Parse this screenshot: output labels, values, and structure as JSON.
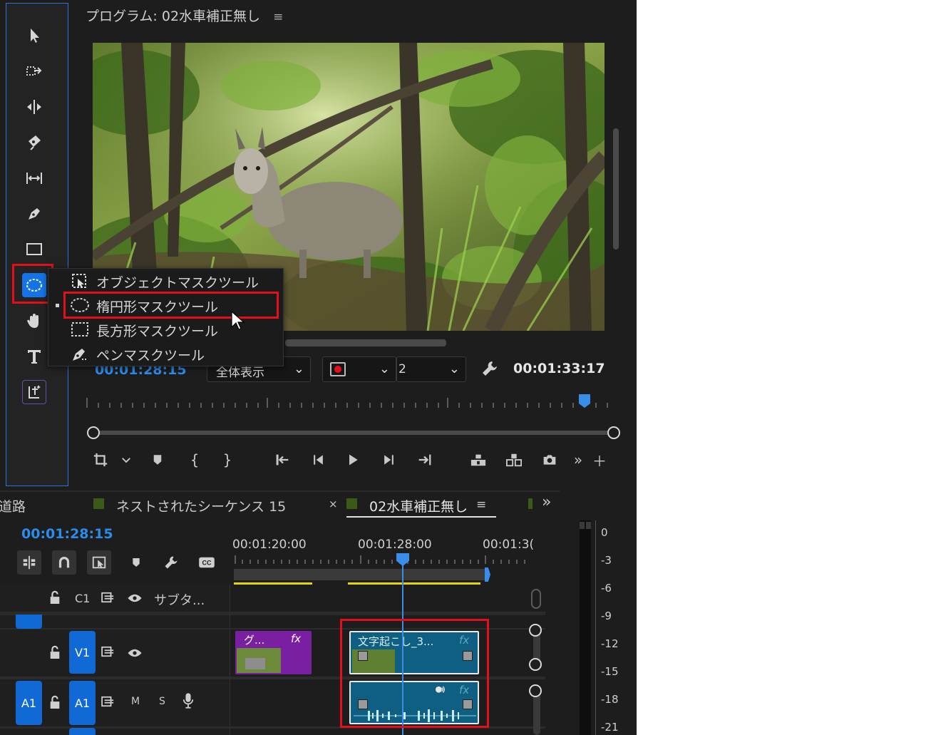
{
  "program_monitor": {
    "title": "プログラム: 02水車補正無し",
    "menu_icon": "≡",
    "timecode_current": "00:01:28:15",
    "timecode_duration": "00:01:33:17",
    "zoom_select": "全体表示",
    "quality_select_suffix": "2"
  },
  "context_menu": {
    "items": [
      {
        "label": "オブジェクトマスクツール",
        "icon": "object-mask-icon"
      },
      {
        "label": "楕円形マスクツール",
        "icon": "ellipse-mask-icon",
        "selected": true
      },
      {
        "label": "長方形マスクツール",
        "icon": "rectangle-mask-icon"
      },
      {
        "label": "ペンマスクツール",
        "icon": "pen-mask-icon"
      }
    ]
  },
  "timeline": {
    "tabs": [
      {
        "label": "道路"
      },
      {
        "label": "ネストされたシーケンス 15"
      },
      {
        "label": "02水車補正無し",
        "active": true
      }
    ],
    "close_icon": "×",
    "menu_icon": "≡",
    "overflow_icon": "»",
    "timecode": "00:01:28:15",
    "ruler": [
      "00:01:20:00",
      "00:01:28:00",
      "00:01:3("
    ],
    "tracks": {
      "c1": {
        "label": "C1",
        "name": "サブタ..."
      },
      "v1": {
        "label": "V1"
      },
      "a1_source": "A1",
      "a1": {
        "label": "A1",
        "m": "M",
        "s": "S"
      }
    },
    "clips": {
      "v1_purple": {
        "label": "グ...",
        "fx": "fx"
      },
      "v1_blue": {
        "label": "文字起こし_3...",
        "fx": "fx"
      },
      "a1_blue": {
        "fx": "fx"
      }
    }
  },
  "audio_meter": {
    "labels": [
      "0",
      "-3",
      "-6",
      "-9",
      "-12",
      "-15",
      "-18",
      "-21"
    ]
  },
  "colors": {
    "accent": "#1473e6",
    "timecode_blue": "#2d8ceb",
    "highlight_red": "#e3101c",
    "clip_blue": "#0f5f82",
    "clip_purple": "#7b1fa2"
  }
}
